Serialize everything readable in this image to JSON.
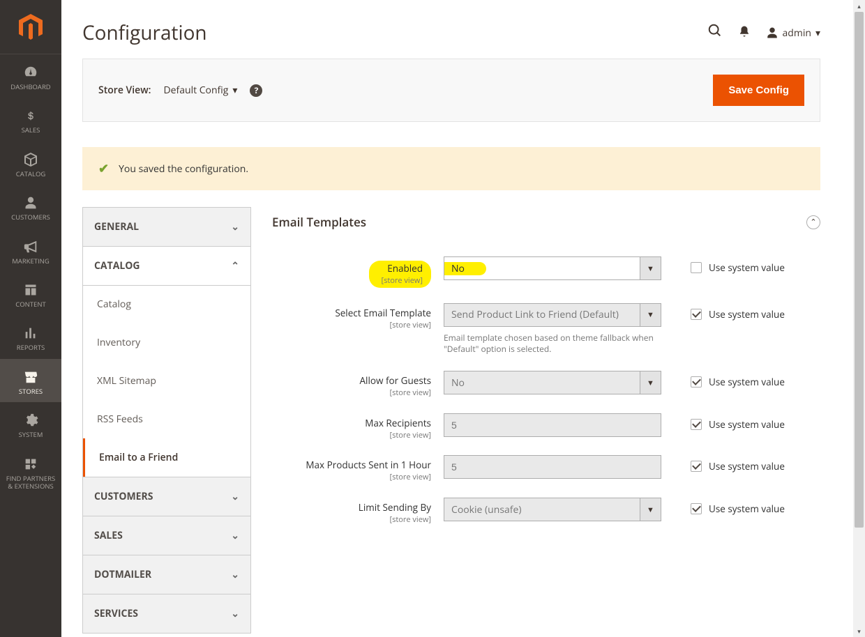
{
  "header": {
    "title": "Configuration",
    "admin_label": "admin",
    "store_view_label": "Store View:",
    "store_view_value": "Default Config",
    "save_button": "Save Config"
  },
  "message": {
    "text": "You saved the configuration."
  },
  "sidebar": {
    "tabs": [
      {
        "label": "GENERAL",
        "type": "head",
        "collapsed": true
      },
      {
        "label": "CATALOG",
        "type": "head",
        "collapsed": false
      },
      {
        "label": "CUSTOMERS",
        "type": "head",
        "collapsed": true
      },
      {
        "label": "SALES",
        "type": "head",
        "collapsed": true
      },
      {
        "label": "DOTMAILER",
        "type": "head",
        "collapsed": true
      },
      {
        "label": "SERVICES",
        "type": "head",
        "collapsed": true
      }
    ],
    "catalog_items": [
      "Catalog",
      "Inventory",
      "XML Sitemap",
      "RSS Feeds",
      "Email to a Friend"
    ]
  },
  "nav": [
    {
      "label": "DASHBOARD",
      "icon": "dashboard"
    },
    {
      "label": "SALES",
      "icon": "dollar"
    },
    {
      "label": "CATALOG",
      "icon": "cube"
    },
    {
      "label": "CUSTOMERS",
      "icon": "person"
    },
    {
      "label": "MARKETING",
      "icon": "megaphone"
    },
    {
      "label": "CONTENT",
      "icon": "content"
    },
    {
      "label": "REPORTS",
      "icon": "reports"
    },
    {
      "label": "STORES",
      "icon": "stores",
      "active": true
    },
    {
      "label": "SYSTEM",
      "icon": "gear"
    },
    {
      "label": "FIND PARTNERS\n& EXTENSIONS",
      "icon": "ext"
    }
  ],
  "section": {
    "title": "Email Templates",
    "use_system_label": "Use system value",
    "scope_label": "[store view]",
    "rows": [
      {
        "label": "Enabled",
        "value": "No",
        "type": "select",
        "disabled": false,
        "use_sys": false,
        "highlight": true
      },
      {
        "label": "Select Email Template",
        "value": "Send Product Link to Friend (Default)",
        "type": "select",
        "disabled": true,
        "use_sys": true,
        "help": "Email template chosen based on theme fallback when \"Default\" option is selected."
      },
      {
        "label": "Allow for Guests",
        "value": "No",
        "type": "select",
        "disabled": true,
        "use_sys": true
      },
      {
        "label": "Max Recipients",
        "value": "5",
        "type": "input",
        "disabled": true,
        "use_sys": true
      },
      {
        "label": "Max Products Sent in 1 Hour",
        "value": "5",
        "type": "input",
        "disabled": true,
        "use_sys": true
      },
      {
        "label": "Limit Sending By",
        "value": "Cookie (unsafe)",
        "type": "select",
        "disabled": true,
        "use_sys": true
      }
    ]
  },
  "colors": {
    "accent": "#eb5202"
  }
}
